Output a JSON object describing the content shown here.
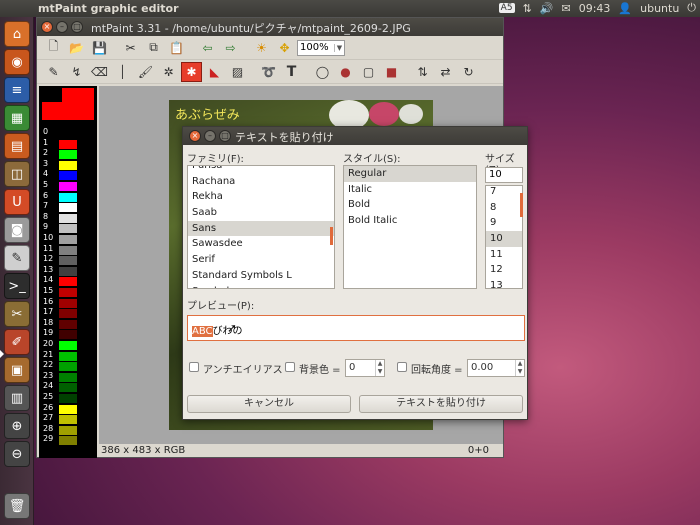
{
  "topbar": {
    "app_title": "mtPaint graphic editor",
    "ime": "A5",
    "time": "09:43",
    "user": "ubuntu"
  },
  "launcher": {
    "items": [
      "home-folder",
      "firefox",
      "writer",
      "calc",
      "impress",
      "software-center",
      "ubuntu-one",
      "screenshot",
      "text-editor",
      "terminal",
      "paint-tools",
      "color-pencils",
      "image-viewer",
      "workspace",
      "zoom-in",
      "zoom-out",
      "trash"
    ]
  },
  "window": {
    "title": "mtPaint 3.31 - /home/ubuntu/ピクチャ/mtpaint_2609-2.JPG",
    "zoom": "100%",
    "palette_numbers": [
      "0",
      "1",
      "2",
      "3",
      "4",
      "5",
      "6",
      "7",
      "8",
      "9",
      "10",
      "11",
      "12",
      "13",
      "14",
      "15",
      "16",
      "17",
      "18",
      "19",
      "20",
      "21",
      "22",
      "23",
      "24",
      "25",
      "26",
      "27",
      "28",
      "29"
    ],
    "palette_colors": [
      "#000000",
      "#ff0000",
      "#00ff00",
      "#ffff00",
      "#0000ff",
      "#ff00ff",
      "#00ffff",
      "#ffffff",
      "#e0e0e0",
      "#c0c0c0",
      "#a0a0a0",
      "#808080",
      "#606060",
      "#404040",
      "#ff0000",
      "#c00000",
      "#a00000",
      "#800000",
      "#600000",
      "#400000",
      "#00ff00",
      "#00c000",
      "#00a000",
      "#008000",
      "#006000",
      "#004000",
      "#ffff00",
      "#c0c000",
      "#a0a000",
      "#808000"
    ],
    "photo_label": "あぶらぜみ",
    "status_size": "386 x 483 x RGB",
    "status_coords": "0+0"
  },
  "dialog": {
    "title": "テキストを貼り付け",
    "family_label": "ファミリ(F):",
    "style_label": "スタイル(S):",
    "size_label": "サイズ(Z):",
    "families": [
      "Purisa",
      "Rachana",
      "Rekha",
      "Saab",
      "Sans",
      "Sawasdee",
      "Serif",
      "Standard Symbols L",
      "Symbol"
    ],
    "styles": [
      "Regular",
      "Italic",
      "Bold",
      "Bold Italic"
    ],
    "size_value": "10",
    "sizes": [
      "7",
      "8",
      "9",
      "10",
      "11",
      "12",
      "13"
    ],
    "preview_label": "プレビュー(P):",
    "preview_highlight": "ABC",
    "preview_text": "びわの",
    "antialias_label": "アンチエイリアス",
    "bg_label": "背景色 =",
    "bg_value": "0",
    "rotate_label": "回転角度 =",
    "rotate_value": "0.00",
    "cancel_label": "キャンセル",
    "paste_label": "テキストを貼り付け"
  }
}
